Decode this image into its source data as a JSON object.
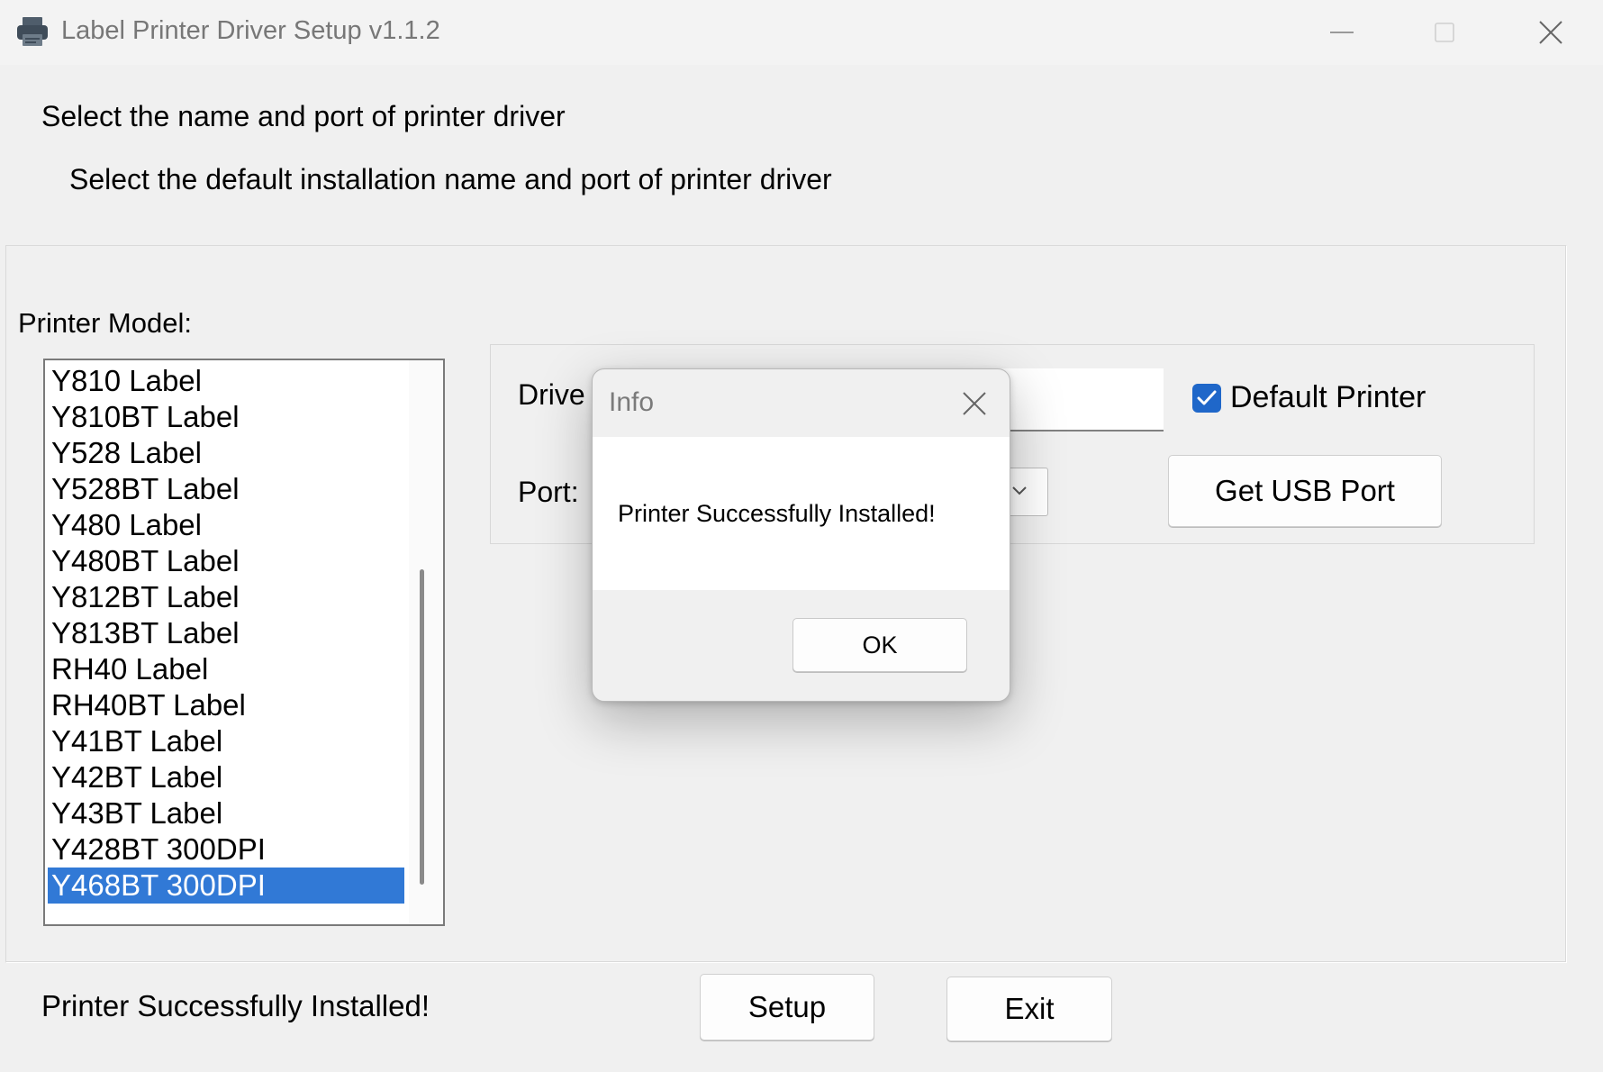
{
  "window": {
    "title": "Label Printer Driver Setup v1.1.2",
    "icon": "printer-icon",
    "controls": [
      "minimize-icon",
      "maximize-icon",
      "close-icon"
    ]
  },
  "header": {
    "title": "Select the name and port of printer driver",
    "subtitle": "Select the default installation name and port of printer driver"
  },
  "model": {
    "label": "Printer Model:",
    "items": [
      "Y810 Label",
      "Y810BT Label",
      "Y528 Label",
      "Y528BT Label",
      "Y480 Label",
      "Y480BT Label",
      "Y812BT Label",
      "Y813BT Label",
      "RH40 Label",
      "RH40BT Label",
      "Y41BT Label",
      "Y42BT Label",
      "Y43BT Label",
      "Y428BT 300DPI",
      "Y468BT 300DPI"
    ],
    "selected": "Y468BT 300DPI"
  },
  "driver": {
    "name_label": "Drive",
    "name_value": "",
    "default_checked": true,
    "default_label": "Default Printer",
    "port_label": "Port:",
    "port_value": "",
    "usb_button": "Get USB Port"
  },
  "footer": {
    "status": "Printer Successfully Installed!",
    "setup_button": "Setup",
    "exit_button": "Exit"
  },
  "dialog": {
    "title": "Info",
    "message": "Printer Successfully Installed!",
    "ok_button": "OK"
  },
  "colors": {
    "background": "#f0f0f0",
    "selection": "#3179d6",
    "checkbox": "#1f67c9"
  }
}
